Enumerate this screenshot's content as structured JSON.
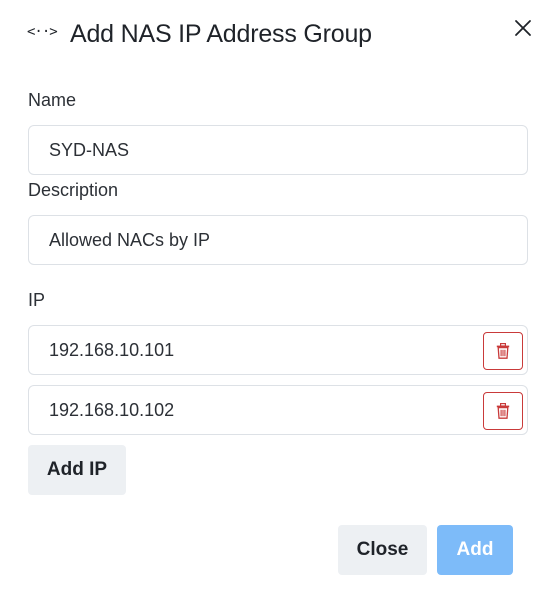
{
  "dialog": {
    "title": "Add NAS IP Address Group",
    "header_icon": "<··>",
    "header_icon_name": "arrows-horizontal-icon",
    "close_icon_name": "close-icon"
  },
  "form": {
    "name": {
      "label": "Name",
      "value": "SYD-NAS"
    },
    "description": {
      "label": "Description",
      "value": "Allowed NACs by IP"
    },
    "ip": {
      "label": "IP",
      "entries": [
        {
          "value": "192.168.10.101",
          "delete_icon": "trash-icon"
        },
        {
          "value": "192.168.10.102",
          "delete_icon": "trash-icon"
        }
      ],
      "add_label": "Add IP"
    }
  },
  "footer": {
    "close_label": "Close",
    "add_label": "Add"
  },
  "colors": {
    "primary_disabled": "#7dbbf9",
    "danger": "#c93a3a",
    "secondary_bg": "#edf0f3",
    "border": "#dde1e6"
  }
}
